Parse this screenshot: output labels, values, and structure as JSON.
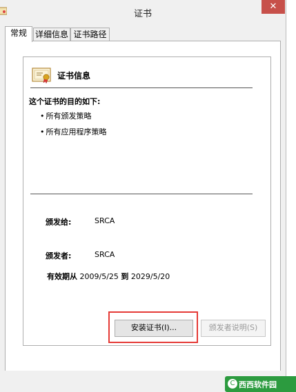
{
  "window": {
    "title": "证书",
    "close_glyph": "✕"
  },
  "tabs": [
    {
      "label": "常规",
      "active": true
    },
    {
      "label": "详细信息",
      "active": false
    },
    {
      "label": "证书路径",
      "active": false
    }
  ],
  "certificate": {
    "heading": "证书信息",
    "purpose_title": "这个证书的目的如下:",
    "purposes": [
      "所有颁发策略",
      "所有应用程序策略"
    ],
    "issued_to_label": "颁发给:",
    "issued_to_value": "SRCA",
    "issued_by_label": "颁发者:",
    "issued_by_value": "SRCA",
    "valid_from_label": "有效期从",
    "valid_from": "2009/5/25",
    "valid_to_label": "到",
    "valid_to": "2029/5/20"
  },
  "buttons": {
    "install": "安装证书(I)...",
    "issuer_statement": "颁发者说明(S)"
  },
  "watermark": {
    "text": "西西软件园"
  },
  "icons": {
    "app": "certificate-icon",
    "heading": "certificate-icon",
    "close": "close-icon"
  },
  "colors": {
    "close_button": "#c7504a",
    "highlight": "#e53935",
    "watermark": "#2c9b3f"
  }
}
